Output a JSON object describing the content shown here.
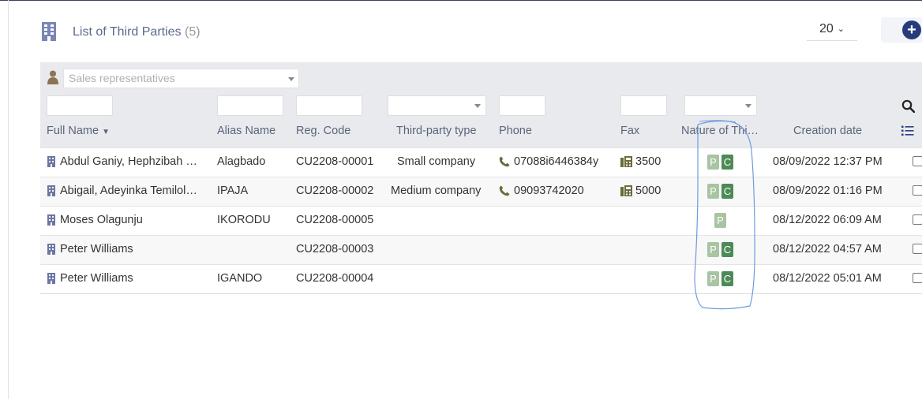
{
  "header": {
    "title": "List of Third Parties",
    "count": "(5)",
    "page_size": "20",
    "icon": "building-icon",
    "add_icon": "plus-circle-icon"
  },
  "filters": {
    "sales_rep_placeholder": "Sales representatives"
  },
  "columns": {
    "full_name": "Full Name",
    "alias": "Alias Name",
    "reg_code": "Reg. Code",
    "type": "Third-party type",
    "phone": "Phone",
    "fax": "Fax",
    "nature": "Nature of Thi…",
    "created": "Creation date"
  },
  "rows": [
    {
      "name": "Abdul Ganiy, Hephzibah …",
      "alias": "Alagbado",
      "code": "CU2208-00001",
      "type": "Small company",
      "phone": "07088i6446384y",
      "fax": "3500",
      "nature": [
        "P",
        "C"
      ],
      "created": "08/09/2022 12:37 PM"
    },
    {
      "name": "Abigail, Adeyinka Temilol…",
      "alias": "IPAJA",
      "code": "CU2208-00002",
      "type": "Medium company",
      "phone": "09093742020",
      "fax": "5000",
      "nature": [
        "P",
        "C"
      ],
      "created": "08/09/2022 01:16 PM"
    },
    {
      "name": "Moses Olagunju",
      "alias": "IKORODU",
      "code": "CU2208-00005",
      "type": "",
      "phone": "",
      "fax": "",
      "nature": [
        "P"
      ],
      "created": "08/12/2022 06:09 AM"
    },
    {
      "name": "Peter Williams",
      "alias": "",
      "code": "CU2208-00003",
      "type": "",
      "phone": "",
      "fax": "",
      "nature": [
        "P",
        "C"
      ],
      "created": "08/12/2022 04:57 AM"
    },
    {
      "name": "Peter Williams",
      "alias": "IGANDO",
      "code": "CU2208-00004",
      "type": "",
      "phone": "",
      "fax": "",
      "nature": [
        "P",
        "C"
      ],
      "created": "08/12/2022 05:01 AM"
    }
  ],
  "colors": {
    "accent": "#263c7a",
    "prospect_badge": "#a9c4a2",
    "customer_badge": "#4e8a56",
    "header_text": "#5a6a8c"
  }
}
